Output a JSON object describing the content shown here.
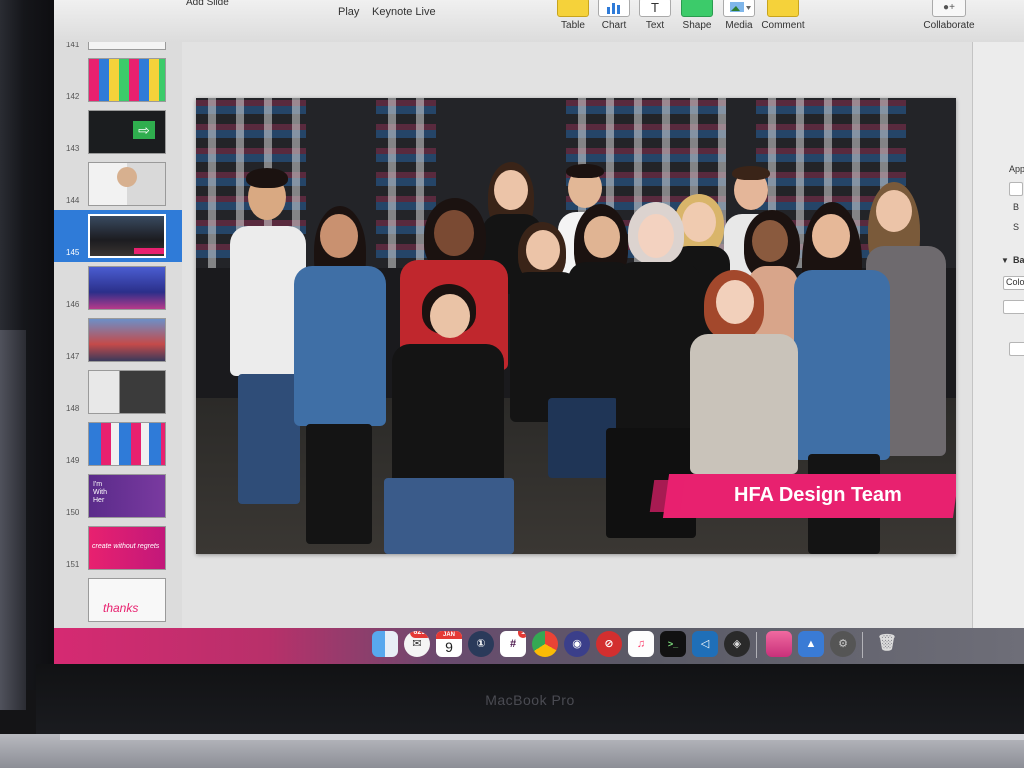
{
  "toolbar": {
    "left_text": "Add Slide",
    "play_label": "Play",
    "keynote_live_label": "Keynote Live",
    "table_label": "Table",
    "chart_label": "Chart",
    "text_label": "Text",
    "shape_label": "Shape",
    "media_label": "Media",
    "comment_label": "Comment",
    "collaborate_label": "Collaborate"
  },
  "navigator": {
    "slides": [
      {
        "number": "141",
        "theme": "grid-sketch"
      },
      {
        "number": "142",
        "theme": "colorful-tiles"
      },
      {
        "number": "143",
        "theme": "exit-sign"
      },
      {
        "number": "144",
        "theme": "portrait"
      },
      {
        "number": "145",
        "theme": "team-photo",
        "selected": true
      },
      {
        "number": "146",
        "theme": "crowd-blue"
      },
      {
        "number": "147",
        "theme": "stage-crowd"
      },
      {
        "number": "148",
        "theme": "portrait-bw"
      },
      {
        "number": "149",
        "theme": "campaign-collage"
      },
      {
        "number": "150",
        "theme": "im-with-her",
        "text": "I'm With Her"
      },
      {
        "number": "151",
        "theme": "pink-create",
        "text": "create without regrets"
      },
      {
        "number": "",
        "theme": "thanks",
        "text": "thanks"
      }
    ]
  },
  "slide": {
    "caption": "HFA Design Team"
  },
  "inspector": {
    "lines": [
      "App",
      "B",
      "S",
      "Ba",
      "Colo"
    ]
  },
  "dock": {
    "mail_badge": "6298",
    "calendar_month": "JAN",
    "calendar_day": "9",
    "slack_badge": "1"
  },
  "hardware": {
    "label": "MacBook Pro"
  },
  "colors": {
    "selection": "#2f7bd8",
    "caption_banner": "#e8216f",
    "dock_pink": "#d62a72"
  }
}
